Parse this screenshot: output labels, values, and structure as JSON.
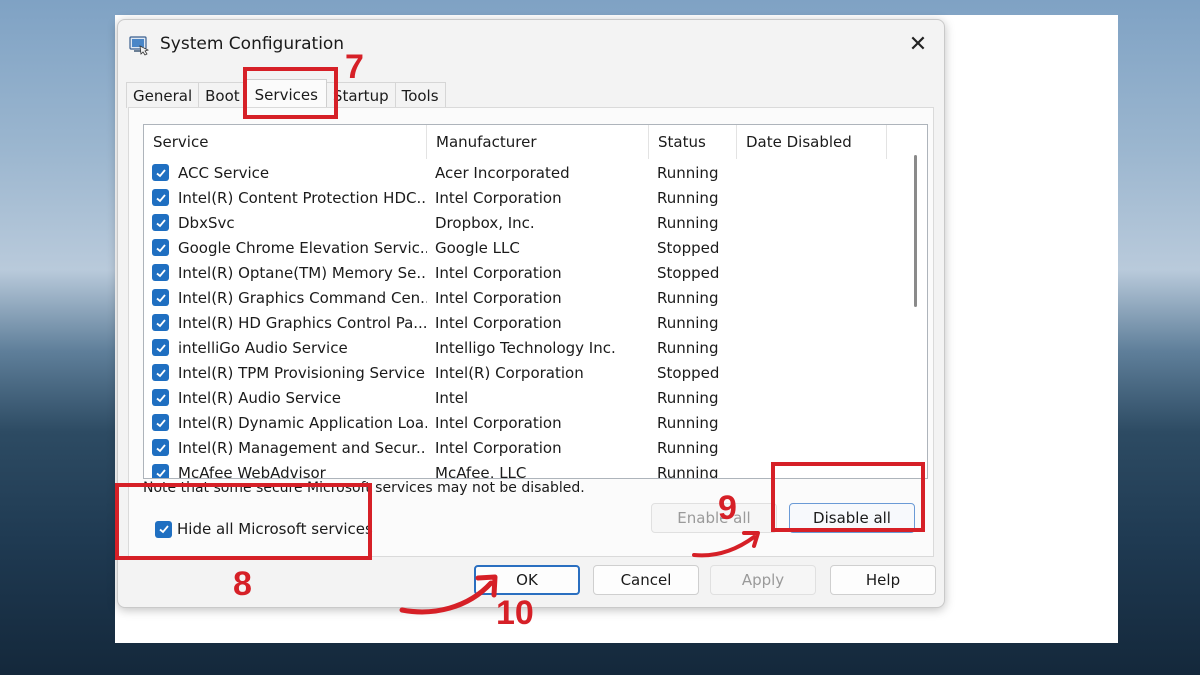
{
  "window": {
    "title": "System Configuration",
    "close_glyph": "✕"
  },
  "tabs": [
    {
      "label": "General"
    },
    {
      "label": "Boot"
    },
    {
      "label": "Services"
    },
    {
      "label": "Startup"
    },
    {
      "label": "Tools"
    }
  ],
  "list": {
    "columns": [
      "Service",
      "Manufacturer",
      "Status",
      "Date Disabled"
    ],
    "rows": [
      {
        "service": "ACC Service",
        "manufacturer": "Acer Incorporated",
        "status": "Running",
        "date": ""
      },
      {
        "service": "Intel(R) Content Protection HDC...",
        "manufacturer": "Intel Corporation",
        "status": "Running",
        "date": ""
      },
      {
        "service": "DbxSvc",
        "manufacturer": "Dropbox, Inc.",
        "status": "Running",
        "date": ""
      },
      {
        "service": "Google Chrome Elevation Servic...",
        "manufacturer": "Google LLC",
        "status": "Stopped",
        "date": ""
      },
      {
        "service": "Intel(R) Optane(TM) Memory Se...",
        "manufacturer": "Intel Corporation",
        "status": "Stopped",
        "date": ""
      },
      {
        "service": "Intel(R) Graphics Command Cen...",
        "manufacturer": "Intel Corporation",
        "status": "Running",
        "date": ""
      },
      {
        "service": "Intel(R) HD Graphics Control Pa...",
        "manufacturer": "Intel Corporation",
        "status": "Running",
        "date": ""
      },
      {
        "service": "intelliGo Audio Service",
        "manufacturer": "Intelligo Technology Inc.",
        "status": "Running",
        "date": ""
      },
      {
        "service": "Intel(R) TPM Provisioning Service",
        "manufacturer": "Intel(R) Corporation",
        "status": "Stopped",
        "date": ""
      },
      {
        "service": "Intel(R) Audio Service",
        "manufacturer": "Intel",
        "status": "Running",
        "date": ""
      },
      {
        "service": "Intel(R) Dynamic Application Loa...",
        "manufacturer": "Intel Corporation",
        "status": "Running",
        "date": ""
      },
      {
        "service": "Intel(R) Management and Secur...",
        "manufacturer": "Intel Corporation",
        "status": "Running",
        "date": ""
      },
      {
        "service": "McAfee WebAdvisor",
        "manufacturer": "McAfee, LLC",
        "status": "Running",
        "date": ""
      }
    ]
  },
  "note": "Note that some secure Microsoft services may not be disabled.",
  "enable_all_label": "Enable all",
  "disable_all_label": "Disable all",
  "hide_ms_label": "Hide all Microsoft services",
  "footer": {
    "ok": "OK",
    "cancel": "Cancel",
    "apply": "Apply",
    "help": "Help"
  },
  "annotations": {
    "n7": "7",
    "n8": "8",
    "n9": "9",
    "n10": "10",
    "color": "#d62027"
  },
  "colors": {
    "checkbox": "#1f6fc1",
    "primary_border": "#2a6fc0"
  }
}
